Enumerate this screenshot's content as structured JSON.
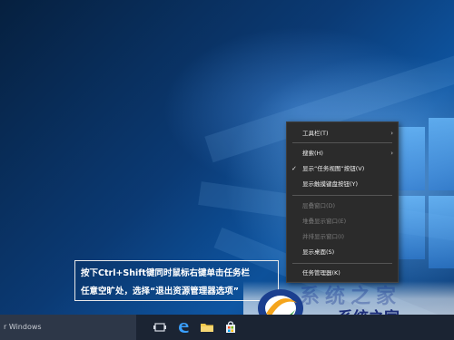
{
  "taskbar": {
    "search_placeholder": "r Windows"
  },
  "context_menu": {
    "items": [
      {
        "label": "工具栏(T)"
      },
      {
        "label": "搜索(H)"
      },
      {
        "label": "显示“任务视图”按钮(V)"
      },
      {
        "label": "显示触摸键盘按钮(Y)"
      },
      {
        "label": "层叠窗口(D)"
      },
      {
        "label": "堆叠显示窗口(E)"
      },
      {
        "label": "并排显示窗口(I)"
      },
      {
        "label": "显示桌面(S)"
      },
      {
        "label": "任务管理器(K)"
      }
    ]
  },
  "caption": {
    "line1": "按下Ctrl+Shift键同时鼠标右键单击任务栏",
    "line2": "任意空旷处，选择“退出资源管理器选项”"
  },
  "watermark": {
    "text": "系统之家"
  },
  "colors": {
    "menu_bg": "#2b2b2b",
    "taskbar_bg": "#1b2433",
    "desktop_accent": "#0e56a3"
  }
}
